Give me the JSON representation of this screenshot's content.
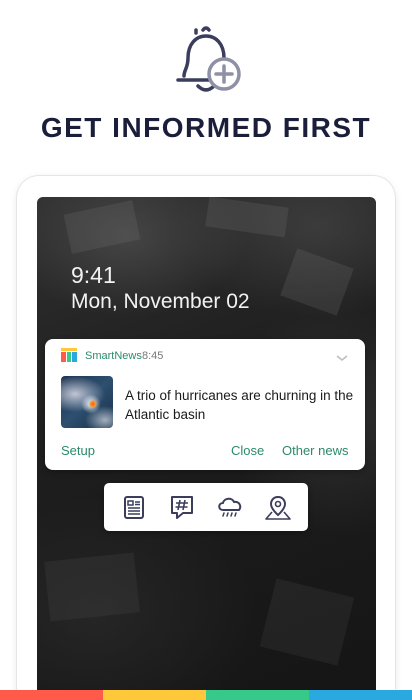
{
  "hero": {
    "icon": "bell-plus-icon",
    "headline": "GET INFORMED FIRST"
  },
  "lockscreen": {
    "time": "9:41",
    "date": "Mon, November 02"
  },
  "notification": {
    "app_icon": "smartnews-app-icon",
    "app_name": "SmartNews",
    "time": "8:45",
    "expand_icon": "chevron-down-icon",
    "thumbnail": "hurricane-satellite-thumbnail",
    "text": "A trio of hurricanes are churning in the Atlantic basin",
    "actions": {
      "setup": "Setup",
      "close": "Close",
      "other": "Other news"
    }
  },
  "dock": {
    "icons": [
      "news-list-icon",
      "hashtag-icon",
      "weather-rain-icon",
      "map-pin-icon"
    ]
  },
  "colors": {
    "accent": "#2c8a6a",
    "headline": "#1b1e3a",
    "strip": [
      "#ff5a4a",
      "#ffc83a",
      "#36c98a",
      "#2aa8e0"
    ]
  }
}
